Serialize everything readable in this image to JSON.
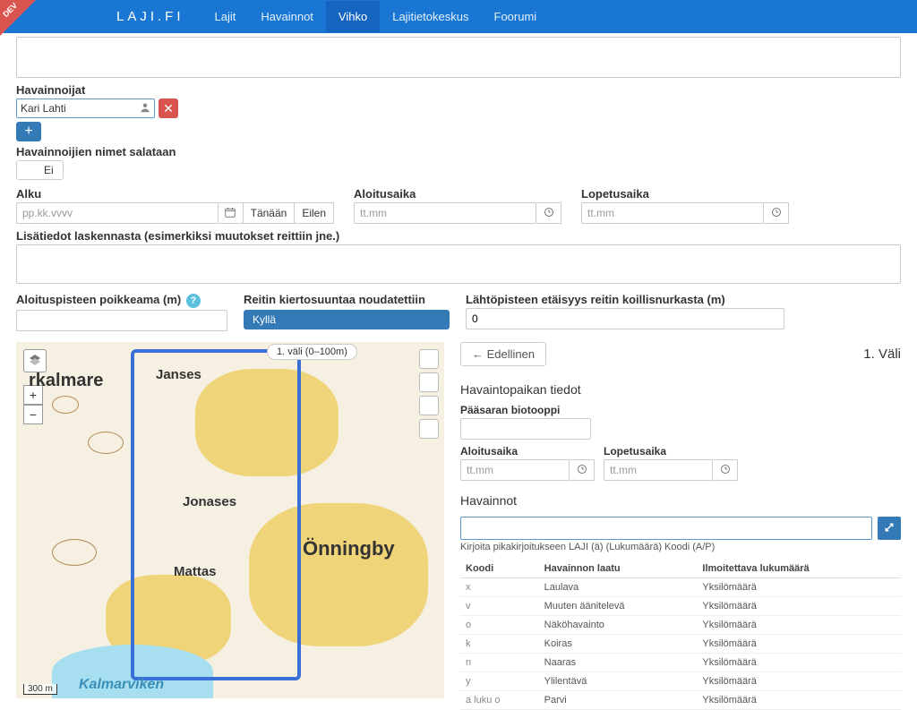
{
  "dev_badge": "DEV",
  "nav": {
    "brand": "LAJI.FI",
    "items": [
      "Lajit",
      "Havainnot",
      "Vihko",
      "Lajitietokeskus",
      "Foorumi"
    ],
    "active_index": 2
  },
  "observers": {
    "label": "Havainnoijat",
    "tag": "Kari Lahti",
    "hidden_label": "Havainnoijien nimet salataan",
    "hidden_value": "Ei"
  },
  "datetime": {
    "alku_label": "Alku",
    "alku_placeholder": "pp.kk.vvvv",
    "tanaan": "Tänään",
    "eilen": "Eilen",
    "aloitus_label": "Aloitusaika",
    "aloitus_placeholder": "tt.mm",
    "lopetus_label": "Lopetusaika",
    "lopetus_placeholder": "tt.mm"
  },
  "lisatiedot_label": "Lisätiedot laskennasta (esimerkiksi muutokset reittiin jne.)",
  "bottom": {
    "poikkeama_label": "Aloituspisteen poikkeama (m)",
    "reitin_label": "Reitin kiertosuuntaa noudatettiin",
    "reitin_value": "Kyllä",
    "lahto_label": "Lähtöpisteen etäisyys reitin koillisnurkasta (m)",
    "lahto_value": "0"
  },
  "map": {
    "info_pill": "1. väli (0–100m)",
    "scale": "300 m",
    "labels": {
      "rkalmare": "rkalmare",
      "janses": "Janses",
      "jonases": "Jonases",
      "mattas": "Mattas",
      "onningby": "Önningby",
      "kalmarviken": "Kalmarviken"
    }
  },
  "right": {
    "prev": "← Edellinen",
    "title": "1. Väli",
    "havaintopaikan": "Havaintopaikan tiedot",
    "paasaran": "Pääsaran biotooppi",
    "aloitus_label": "Aloitusaika",
    "aloitus_placeholder": "tt.mm",
    "lopetus_label": "Lopetusaika",
    "lopetus_placeholder": "tt.mm",
    "havainnot": "Havainnot",
    "hint": "Kirjoita pikakirjoitukseen LAJI (ä) (Lukumäärä) Koodi (A/P)",
    "table": {
      "headers": [
        "Koodi",
        "Havainnon laatu",
        "Ilmoitettava lukumäärä"
      ],
      "rows": [
        [
          "x",
          "Laulava",
          "Yksilömäärä"
        ],
        [
          "v",
          "Muuten äänitelevä",
          "Yksilömäärä"
        ],
        [
          "o",
          "Näköhavainto",
          "Yksilömäärä"
        ],
        [
          "k",
          "Koiras",
          "Yksilömäärä"
        ],
        [
          "n",
          "Naaras",
          "Yksilömäärä"
        ],
        [
          "y",
          "Ylilentävä",
          "Yksilömäärä"
        ],
        [
          "a luku o",
          "Parvi",
          "Yksilömäärä"
        ]
      ]
    }
  }
}
